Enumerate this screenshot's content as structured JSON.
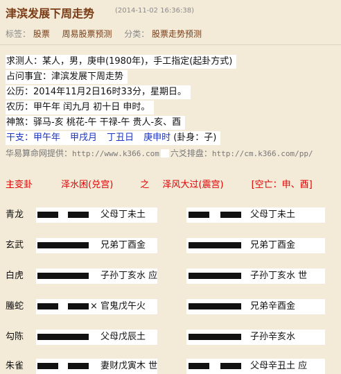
{
  "header": {
    "title": "津滨发展下周走势",
    "timestamp": "(2014-11-02 16:36:38)"
  },
  "meta": {
    "tags_label": "标签：",
    "tags": [
      "股票",
      "周易股票预测"
    ],
    "category_label": "分类：",
    "category": "股票走势预测"
  },
  "info": {
    "asker": "求测人：某人，男，庚申(1980年)，手工指定(起卦方式)",
    "question": "占问事宜：津滨发展下周走势",
    "solar": "公历：2014年11月2日16时33分，星期日。",
    "lunar": "农历：甲午年 闰九月 初十日 申时。",
    "shensha": "神煞：驿马-亥  桃花-午  干禄-午  贵人-亥、酉",
    "ganzhi_label": "干支：",
    "ganzhi": [
      "甲午年",
      "甲戌月",
      "丁丑日",
      "庚申时"
    ],
    "guashen": "(卦身：子)"
  },
  "site": {
    "provider_label": "华易算命网提供：",
    "provider_url": "http://www.k366.com",
    "panel_label": "六爻排盘：",
    "panel_url": "http://cm.k366.com/pp/"
  },
  "gua_header": {
    "label": "主变卦",
    "main": "泽水困(兑宫)",
    "joiner": "之",
    "changed": "泽风大过(震宫)",
    "void": "[空亡：申、酉]"
  },
  "lines": [
    {
      "god": "青龙",
      "left_yin": true,
      "mark": "",
      "left_text": "父母丁未土",
      "right_yin": true,
      "right_text": "父母丁未土"
    },
    {
      "god": "玄武",
      "left_yin": false,
      "mark": "",
      "left_text": "兄弟丁酉金",
      "right_yin": false,
      "right_text": "兄弟丁酉金"
    },
    {
      "god": "白虎",
      "left_yin": false,
      "mark": "",
      "left_text": "子孙丁亥水 应",
      "right_yin": false,
      "right_text": "子孙丁亥水 世"
    },
    {
      "god": "螣蛇",
      "left_yin": true,
      "mark": "×",
      "left_text": "官鬼戊午火",
      "right_yin": false,
      "right_text": "兄弟辛酉金"
    },
    {
      "god": "勾陈",
      "left_yin": false,
      "mark": "",
      "left_text": "父母戊辰土",
      "right_yin": false,
      "right_text": "子孙辛亥水"
    },
    {
      "god": "朱雀",
      "left_yin": true,
      "mark": "",
      "left_text": "妻财戊寅木 世",
      "right_yin": true,
      "right_text": "父母辛丑土 应"
    }
  ]
}
